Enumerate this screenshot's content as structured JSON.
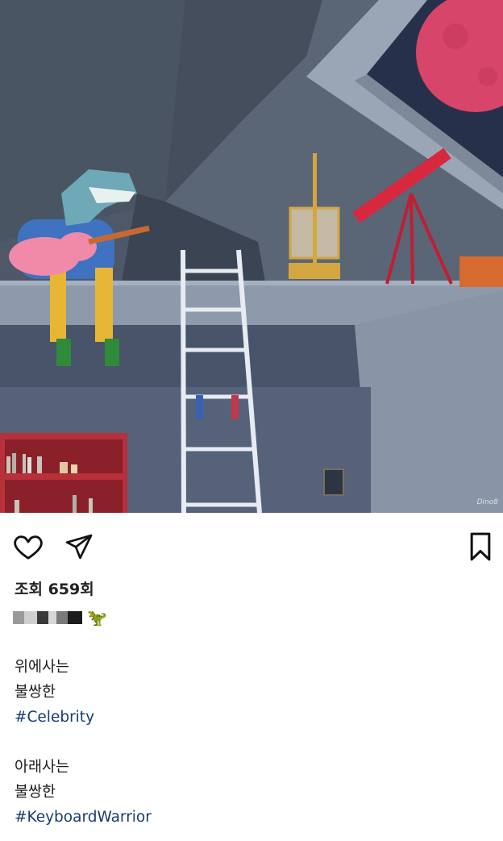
{
  "post": {
    "image": {
      "description_icon": "dinosaur-playing-guitar-in-attic-illustration",
      "artist_signature": "Dino8"
    },
    "actions": {
      "like_icon": "heart-icon",
      "share_icon": "paper-plane-icon",
      "save_icon": "bookmark-icon"
    },
    "views_label": "조회 659회",
    "account": {
      "emoji": "🦖"
    },
    "caption": {
      "line1": "위에사는",
      "line2": "불쌍한",
      "tag1": "#Celebrity",
      "line3": "아래사는",
      "line4": "불쌍한",
      "tag2": "#KeyboardWarrior"
    },
    "colors": {
      "hashtag": "#173b73",
      "moon": "#d8456a",
      "telescope": "#d8283e"
    }
  }
}
